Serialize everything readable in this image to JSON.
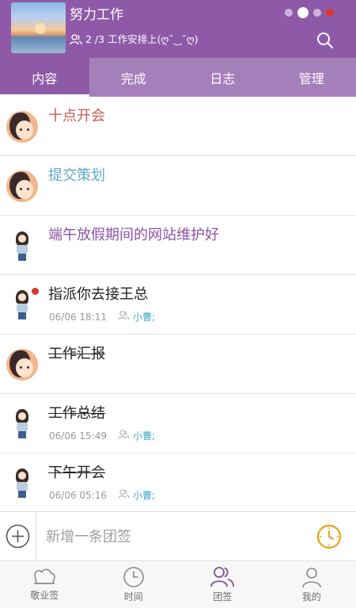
{
  "header": {
    "title": "努力工作",
    "subtitle": "2  /3 工作安排上(ღ˘‿˘ღ)",
    "page_dots": 4,
    "active_dot": 2,
    "colors": {
      "header": "#8e5aa8",
      "tabs": "#a57fba",
      "unread": "#d13a2c",
      "accent": "#3aa3c9"
    }
  },
  "tabs": [
    {
      "label": "内容",
      "active": true
    },
    {
      "label": "完成",
      "active": false
    },
    {
      "label": "日志",
      "active": false
    },
    {
      "label": "管理",
      "active": false
    }
  ],
  "items": [
    {
      "title": "十点开会",
      "title_color": "#c9594f",
      "avatar": "face-avatar",
      "unread": false,
      "strike": false,
      "time": "",
      "assignee": ""
    },
    {
      "title": "提交策划",
      "title_color": "#5ea9c8",
      "avatar": "face-avatar",
      "unread": false,
      "strike": false,
      "time": "",
      "assignee": ""
    },
    {
      "title": "端午放假期间的网站维护好",
      "title_color": "#8b53a6",
      "avatar": "girl-avatar",
      "unread": false,
      "strike": false,
      "time": "",
      "assignee": ""
    },
    {
      "title": "指派你去接王总",
      "title_color": "#222222",
      "avatar": "girl-avatar",
      "unread": true,
      "strike": false,
      "time": "06/06 18:11",
      "assignee": "小曹;"
    },
    {
      "title": "工作汇报",
      "title_color": "#222222",
      "avatar": "face-avatar",
      "unread": false,
      "strike": true,
      "time": "",
      "assignee": ""
    },
    {
      "title": "工作总结",
      "title_color": "#222222",
      "avatar": "girl-avatar",
      "unread": false,
      "strike": true,
      "time": "06/06 15:49",
      "assignee": "小曹;"
    },
    {
      "title": "下午开会",
      "title_color": "#222222",
      "avatar": "girl-avatar",
      "unread": false,
      "strike": true,
      "time": "06/06 05:16",
      "assignee": "小曹;"
    }
  ],
  "composer": {
    "placeholder": "新增一条团签"
  },
  "bottom_nav": [
    {
      "label": "敬业签",
      "icon": "cloud-icon",
      "active": false
    },
    {
      "label": "时间",
      "icon": "clock-icon",
      "active": false
    },
    {
      "label": "团签",
      "icon": "team-icon",
      "active": true
    },
    {
      "label": "我的",
      "icon": "person-icon",
      "active": false
    }
  ]
}
